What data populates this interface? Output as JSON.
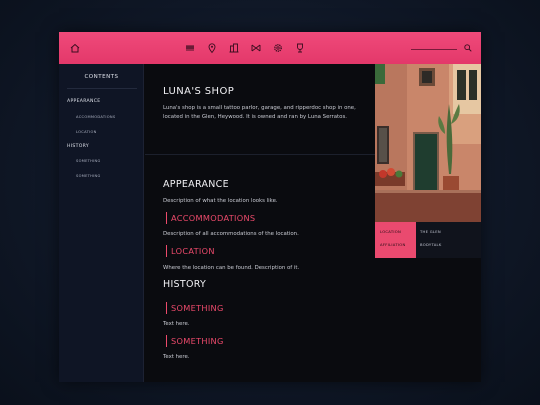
{
  "topbar": {
    "icons": [
      "home-icon",
      "fist-icon",
      "map-pin-icon",
      "buildings-icon",
      "shuffle-icon",
      "gear-icon",
      "trophy-icon"
    ],
    "search": {
      "placeholder": "",
      "value": ""
    },
    "search_icon": "search-icon",
    "accent": "#ea4a6f"
  },
  "sidebar": {
    "title": "CONTENTS",
    "sections": [
      {
        "label": "APPEARANCE",
        "items": [
          "ACCOMMODATIONS",
          "LOCATION"
        ]
      },
      {
        "label": "HISTORY",
        "items": [
          "SOMETHING",
          "SOMETHING"
        ]
      }
    ]
  },
  "article": {
    "title": "LUNA'S SHOP",
    "intro": "Luna's shop is a small tattoo parlor, garage, and ripperdoc shop in one, located in the Glen, Heywood. It is owned and ran by Luna Serratos.",
    "sections": [
      {
        "heading": "APPEARANCE",
        "text": "Description of what the location looks like.",
        "subsections": [
          {
            "heading": "ACCOMMODATIONS",
            "text": "Description of all accommodations of the location."
          },
          {
            "heading": "LOCATION",
            "text": "Where the location can be found. Description of it."
          }
        ]
      },
      {
        "heading": "HISTORY",
        "subsections": [
          {
            "heading": "SOMETHING",
            "text": "Text here."
          },
          {
            "heading": "SOMETHING",
            "text": "Text here."
          }
        ]
      }
    ]
  },
  "infobox": {
    "rows": [
      {
        "key": "LOCATION",
        "value": "THE GLEN"
      },
      {
        "key": "AFFILIATION",
        "value": "BODYTALK"
      }
    ]
  }
}
